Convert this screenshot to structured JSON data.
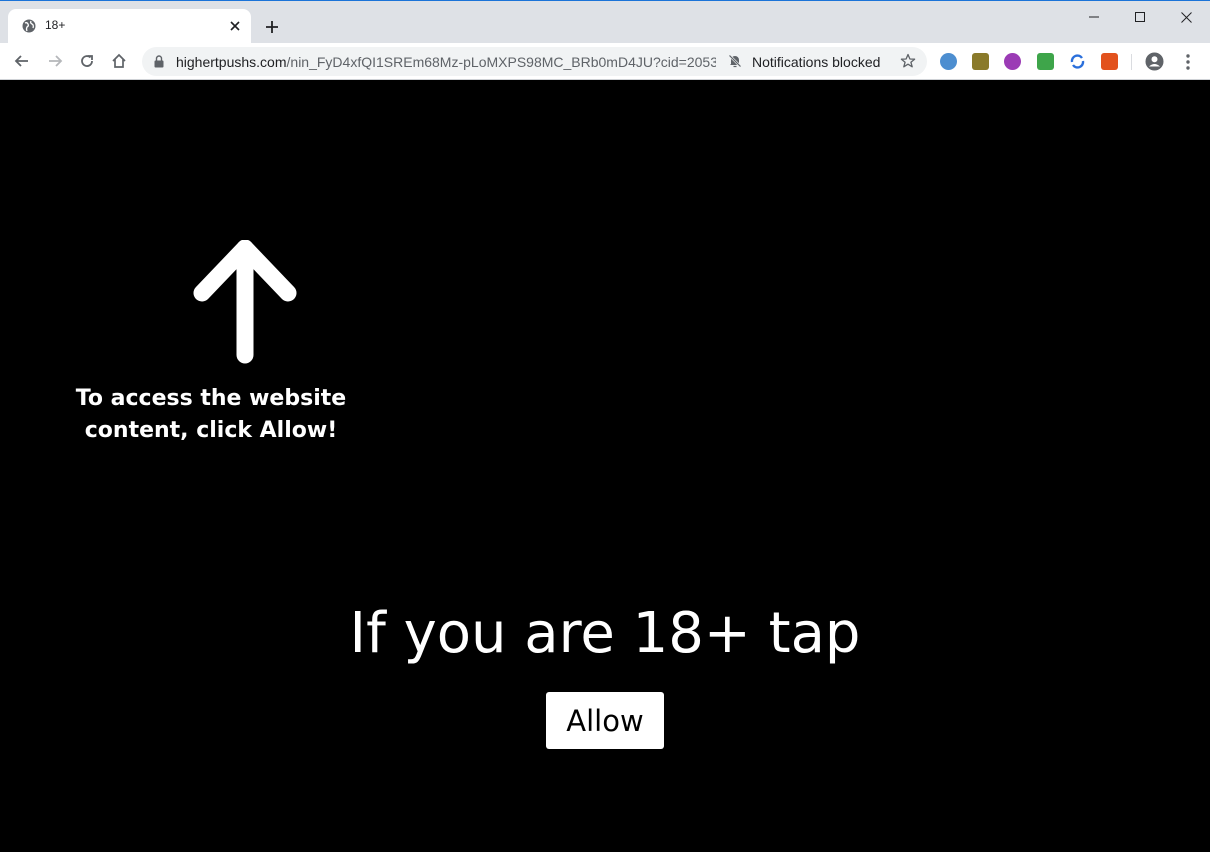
{
  "browser": {
    "tab": {
      "title": "18+",
      "favicon": "globe-icon"
    },
    "new_tab_icon": "plus-icon",
    "window_controls": [
      "minimize-icon",
      "maximize-icon",
      "close-icon"
    ],
    "address_bar": {
      "host": "highertpushs.com",
      "path": "/nin_FyD4xfQI1SREm68Mz-pLoMXPS98MC_BRb0mD4JU?cid=2053...",
      "notifications_status": "Notifications blocked"
    },
    "extensions": [
      "ext-blue-circle",
      "ext-cc",
      "ext-gamepad",
      "ext-green",
      "ext-sync",
      "ext-orange"
    ]
  },
  "page": {
    "hint_line1": "To access the website",
    "hint_line2": "content, click Allow!",
    "headline": "If you are 18+ tap",
    "allow_label": "Allow",
    "colors": {
      "background": "#000000",
      "text": "#ffffff",
      "button_bg": "#ffffff"
    }
  }
}
